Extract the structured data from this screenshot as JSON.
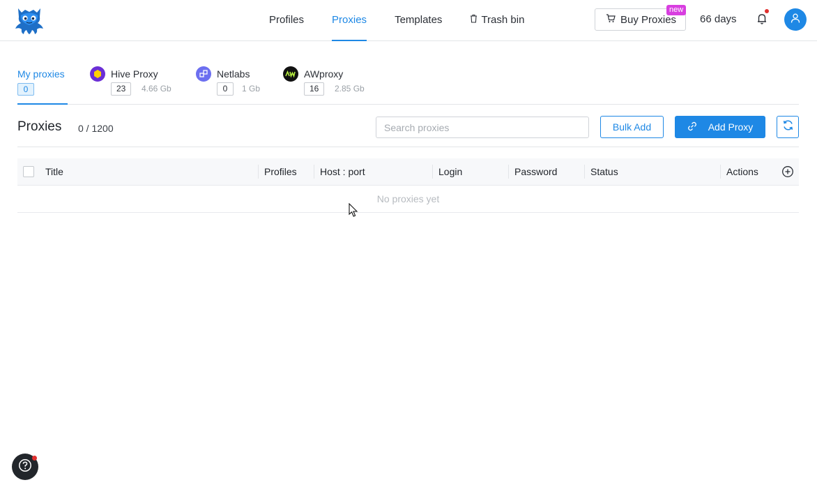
{
  "header": {
    "nav": [
      {
        "label": "Profiles"
      },
      {
        "label": "Proxies",
        "active": true
      },
      {
        "label": "Templates"
      },
      {
        "label": "Trash bin",
        "icon": "trash-icon"
      }
    ],
    "buy_proxies_label": "Buy Proxies",
    "new_badge": "new",
    "days_left": "66 days",
    "accent_color": "#1e88e5"
  },
  "provider_tabs": {
    "mine": {
      "label": "My proxies",
      "count": "0"
    },
    "providers": [
      {
        "name": "Hive Proxy",
        "count": "23",
        "size": "4.66 Gb",
        "icon": "hive-proxy-icon"
      },
      {
        "name": "Netlabs",
        "count": "0",
        "size": "1 Gb",
        "icon": "netlabs-icon"
      },
      {
        "name": "AWproxy",
        "count": "16",
        "size": "2.85 Gb",
        "icon": "awproxy-icon"
      }
    ]
  },
  "toolbar": {
    "title": "Proxies",
    "count": "0 / 1200",
    "search_placeholder": "Search proxies",
    "bulk_add_label": "Bulk Add",
    "add_proxy_label": "Add Proxy"
  },
  "table": {
    "columns": [
      "Title",
      "Profiles",
      "Host : port",
      "Login",
      "Password",
      "Status",
      "Actions"
    ],
    "empty_text": "No proxies yet"
  }
}
